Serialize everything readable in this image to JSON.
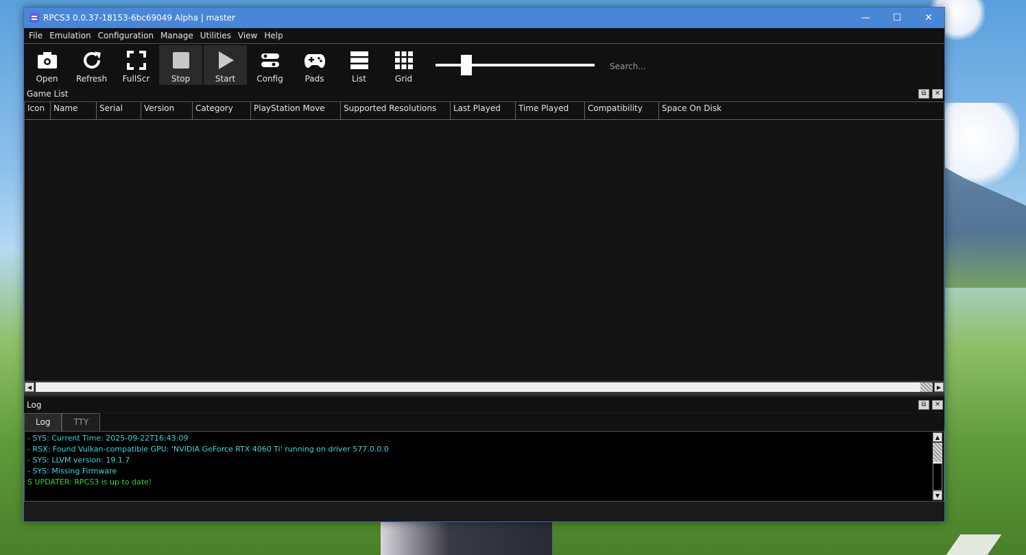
{
  "window": {
    "title": "RPCS3 0.0.37-18153-6bc69049 Alpha | master",
    "controls": {
      "minimize": "—",
      "maximize": "☐",
      "close": "✕"
    }
  },
  "menu": [
    "File",
    "Emulation",
    "Configuration",
    "Manage",
    "Utilities",
    "View",
    "Help"
  ],
  "toolbar": {
    "buttons": [
      {
        "label": "Open",
        "icon": "camera-icon"
      },
      {
        "label": "Refresh",
        "icon": "refresh-icon"
      },
      {
        "label": "FullScr",
        "icon": "fullscreen-icon"
      },
      {
        "label": "Stop",
        "icon": "stop-icon"
      },
      {
        "label": "Start",
        "icon": "play-icon"
      },
      {
        "label": "Config",
        "icon": "config-icon"
      },
      {
        "label": "Pads",
        "icon": "gamepad-icon"
      },
      {
        "label": "List",
        "icon": "list-icon"
      },
      {
        "label": "Grid",
        "icon": "grid-icon"
      }
    ],
    "zoom_slider": {
      "value": 0.17
    },
    "search_placeholder": "Search..."
  },
  "game_list": {
    "title": "Game List",
    "columns": [
      "Icon",
      "Name",
      "Serial",
      "Version",
      "Category",
      "PlayStation Move",
      "Supported Resolutions",
      "Last Played",
      "Time Played",
      "Compatibility",
      "Space On Disk"
    ]
  },
  "log": {
    "title": "Log",
    "tabs": [
      "Log",
      "TTY"
    ],
    "lines": [
      "- SYS: Current Time: 2025-09-22T16:43:09",
      "- RSX: Found Vulkan-compatible GPU: 'NVIDIA GeForce RTX 4060 Ti' running on driver 577.0.0.0",
      "- SYS: LLVM version: 19.1.7",
      "- SYS: Missing Firmware",
      "S UPDATER: RPCS3 is up to date!"
    ]
  },
  "colors": {
    "titlebar": "#4a86d6",
    "log_info": "#3dd6e0",
    "log_success": "#2ed63d"
  }
}
